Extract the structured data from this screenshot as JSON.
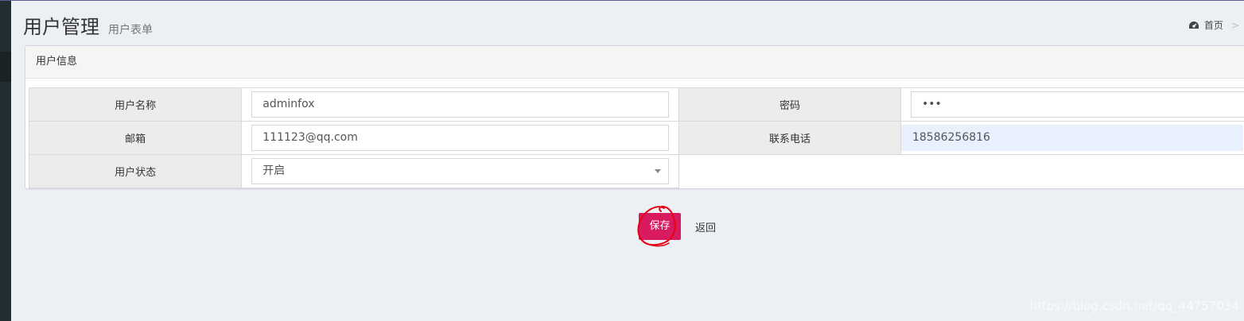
{
  "header": {
    "title": "用户管理",
    "subtitle": "用户表单"
  },
  "breadcrumb": {
    "home_icon": "dashboard-icon",
    "home_label": "首页",
    "separator": ">"
  },
  "panel": {
    "title": "用户信息"
  },
  "form": {
    "username": {
      "label": "用户名称",
      "value": "adminfox"
    },
    "password": {
      "label": "密码",
      "value": "•••"
    },
    "email": {
      "label": "邮箱",
      "value": "111123@qq.com"
    },
    "phone": {
      "label": "联系电话",
      "value": "18586256816"
    },
    "status": {
      "label": "用户状态",
      "value": "开启"
    }
  },
  "actions": {
    "save_label": "保存",
    "back_label": "返回"
  },
  "watermark": "https://blog.csdn.net/qq_44757034",
  "colors": {
    "primary_button": "#d81b60",
    "annotation": "#e60012",
    "background": "#ecf0f5"
  }
}
